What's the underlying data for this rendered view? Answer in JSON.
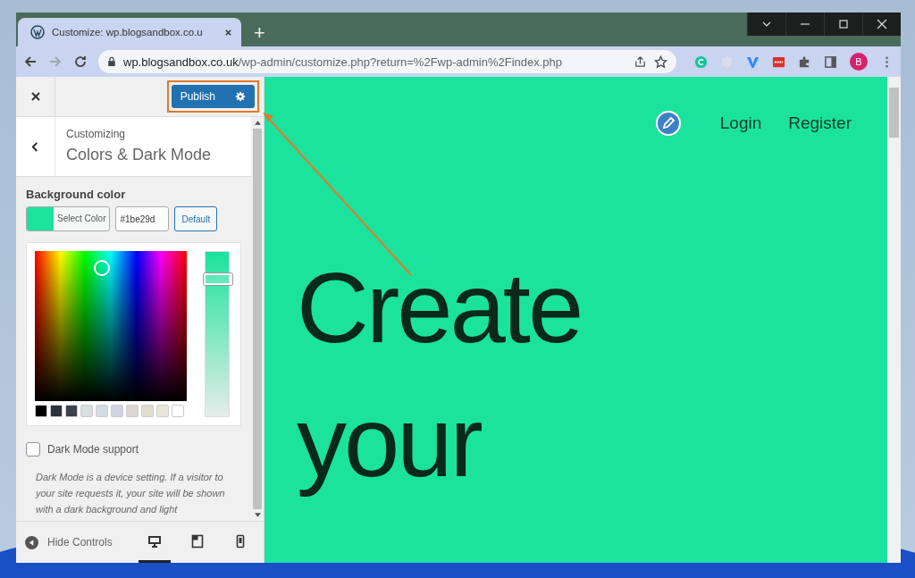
{
  "browser": {
    "tab": {
      "title": "Customize: wp.blogsandbox.co.u",
      "selected": true
    },
    "new_tab": "+",
    "url": {
      "host": "wp.blogsandbox.co.uk",
      "path": "/wp-admin/customize.php?return=%2Fwp-admin%2Findex.php"
    },
    "profile": "B"
  },
  "customizer": {
    "publish": "Publish",
    "breadcrumb": "Customizing",
    "section_title": "Colors & Dark Mode",
    "background_color": {
      "label": "Background color",
      "color": "#1be29d",
      "select_label": "Select Color",
      "hex": "#1be29d",
      "default_label": "Default"
    },
    "palette": [
      {
        "color": "#000000"
      },
      {
        "color": "#2c3338"
      },
      {
        "color": "#3c434a"
      },
      {
        "color": "#d7dfe0"
      },
      {
        "color": "#d2dde2"
      },
      {
        "color": "#d0d4e0"
      },
      {
        "color": "#dcd6d2"
      },
      {
        "color": "#e0dcd0"
      },
      {
        "color": "#e8e6d8"
      },
      {
        "color": "#ffffff"
      }
    ],
    "lightness": {
      "level": 0.87
    },
    "dark_mode": {
      "label": "Dark Mode support",
      "checked": false,
      "description": "Dark Mode is a device setting. If a visitor to your site requests it, your site will be shown with a dark background and light"
    },
    "footer": {
      "hide_controls": "Hide Controls",
      "devices": [
        {
          "kind": "desktop",
          "selected": true
        },
        {
          "kind": "tablet",
          "selected": false
        },
        {
          "kind": "mobile",
          "selected": false
        }
      ]
    }
  },
  "preview": {
    "nav": [
      "Login",
      "Register"
    ],
    "hero": [
      "Create",
      "your"
    ]
  }
}
